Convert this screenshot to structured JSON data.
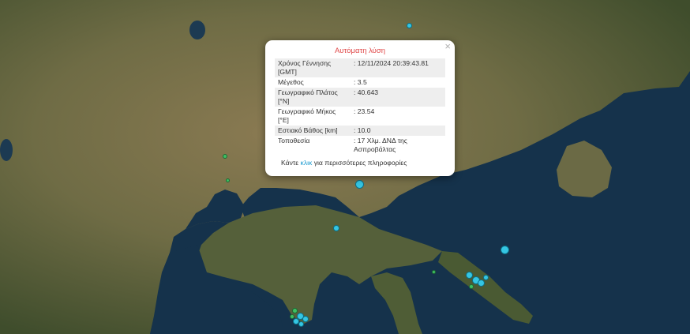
{
  "popup": {
    "title": "Αυτόματη λύση",
    "close_label": "×",
    "rows": [
      {
        "key": "Χρόνος Γέννησης [GMT]",
        "value": ": 12/11/2024 20:39:43.81"
      },
      {
        "key": "Μέγεθος",
        "value": ": 3.5"
      },
      {
        "key": "Γεωγραφικό Πλάτος [°N]",
        "value": ": 40.643"
      },
      {
        "key": "Γεωγραφικό Μήκος [°E]",
        "value": ": 23.54"
      },
      {
        "key": "Εστιακό Βάθος [km]",
        "value": ": 10.0"
      },
      {
        "key": "Τοποθεσία",
        "value": ": 17 Χλμ. ΔΝΔ της Ασπροβάλτας"
      }
    ],
    "more_prefix": "Κάντε ",
    "more_link": "κλικ",
    "more_suffix": " για περισσότερες πληροφορίες"
  },
  "colors": {
    "sea": "#16324a",
    "land": "#6b6a45",
    "marker_cyan": "#35c6e3",
    "marker_green": "#3fbf62",
    "title_red": "#e04848",
    "link_blue": "#1a9ad0"
  }
}
